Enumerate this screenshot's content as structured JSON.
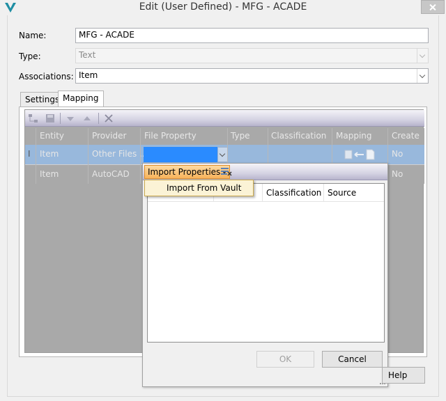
{
  "window": {
    "title": "Edit (User Defined) - MFG - ACADE",
    "logo_icon": "autodesk-vault-icon",
    "close_icon": "close-icon"
  },
  "form": {
    "name_label": "Name:",
    "name_value": "MFG - ACADE",
    "type_label": "Type:",
    "type_value": "Text",
    "associations_label": "Associations:",
    "associations_value": "Item"
  },
  "tabs": [
    {
      "label": "Settings",
      "active": false
    },
    {
      "label": "Mapping",
      "active": true
    }
  ],
  "grid": {
    "columns": [
      "Entity",
      "Provider",
      "File Property",
      "Type",
      "Classification",
      "Mapping",
      "Create"
    ],
    "row_marker": "I",
    "rows": [
      {
        "entity": "Item",
        "provider": "Other Files ...",
        "file_property": "",
        "type": "",
        "classification": "",
        "mapping_icon": "map-arrow-icon",
        "create": "No",
        "selected": true
      },
      {
        "entity": "Item",
        "provider": "AutoCAD",
        "file_property": "",
        "type": "",
        "classification": "",
        "create": "No",
        "selected": false
      }
    ]
  },
  "popup": {
    "import_button_label": "Import Properties",
    "list_columns": [
      "Classification",
      "Source"
    ],
    "ok_label": "OK",
    "cancel_label": "Cancel",
    "menu_item": "Import From Vault"
  },
  "footer": {
    "help_label": "Help"
  },
  "colors": {
    "selection_row": "#98b8dc",
    "editor_highlight": "#2a8bff",
    "import_button": "#f8b35a",
    "menu_bg": "#fbf3d6"
  }
}
